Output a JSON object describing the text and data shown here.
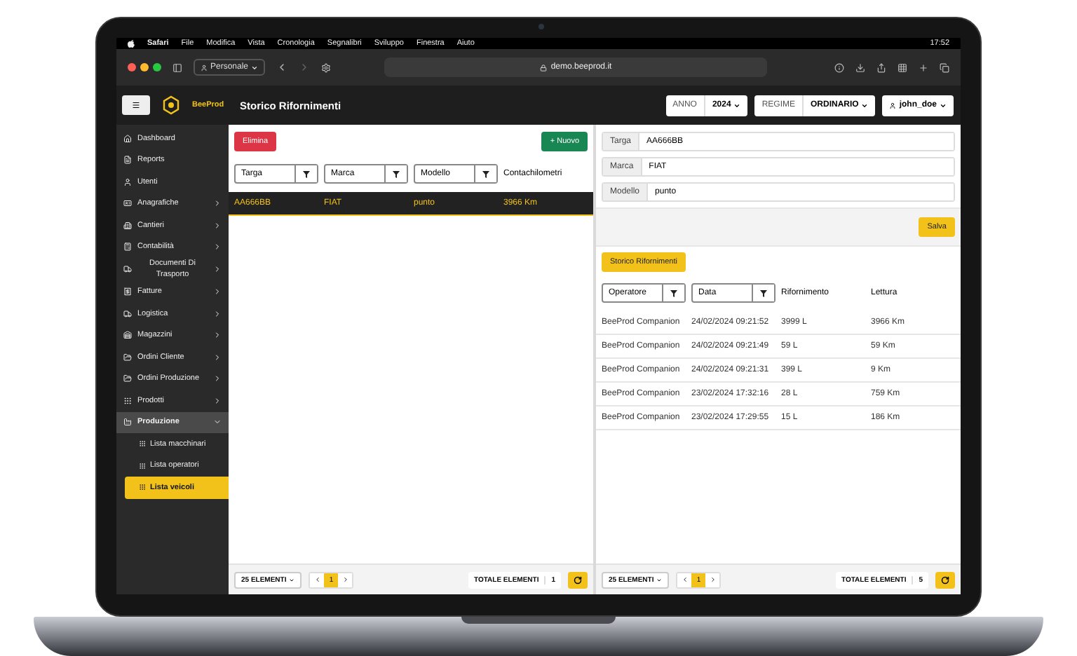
{
  "menubar": {
    "items": [
      "Safari",
      "File",
      "Modifica",
      "Vista",
      "Cronologia",
      "Segnalibri",
      "Sviluppo",
      "Finestra",
      "Aiuto"
    ],
    "time": "17:52"
  },
  "browser": {
    "profile": "Personale",
    "url": "demo.beeprod.it"
  },
  "header": {
    "logo_text": "BeeProd",
    "title": "Storico Rifornimenti",
    "anno_label": "ANNO",
    "anno_value": "2024",
    "regime_label": "REGIME",
    "regime_value": "ORDINARIO",
    "user": "john_doe"
  },
  "sidebar": {
    "items": [
      {
        "label": "Dashboard",
        "submenu": false,
        "expanded": false
      },
      {
        "label": "Reports",
        "submenu": false,
        "expanded": false
      },
      {
        "label": "Utenti",
        "submenu": false,
        "expanded": false
      },
      {
        "label": "Anagrafiche",
        "submenu": true,
        "expanded": false
      },
      {
        "label": "Cantieri",
        "submenu": true,
        "expanded": false
      },
      {
        "label": "Contabilità",
        "submenu": true,
        "expanded": false
      },
      {
        "label": "Documenti Di Trasporto",
        "submenu": true,
        "expanded": false
      },
      {
        "label": "Fatture",
        "submenu": true,
        "expanded": false
      },
      {
        "label": "Logistica",
        "submenu": true,
        "expanded": false
      },
      {
        "label": "Magazzini",
        "submenu": true,
        "expanded": false
      },
      {
        "label": "Ordini Cliente",
        "submenu": true,
        "expanded": false
      },
      {
        "label": "Ordini Produzione",
        "submenu": true,
        "expanded": false
      },
      {
        "label": "Prodotti",
        "submenu": true,
        "expanded": false
      },
      {
        "label": "Produzione",
        "submenu": true,
        "expanded": true,
        "children": [
          {
            "label": "Lista macchinari",
            "selected": false
          },
          {
            "label": "Lista operatori",
            "selected": false
          },
          {
            "label": "Lista veicoli",
            "selected": true
          }
        ]
      }
    ]
  },
  "vehicles": {
    "delete_button": "Elimina",
    "new_button": "+ Nuovo",
    "columns": [
      {
        "kind": "filter",
        "label": "Targa"
      },
      {
        "kind": "filter",
        "label": "Marca"
      },
      {
        "kind": "filter",
        "label": "Modello"
      },
      {
        "kind": "text",
        "label": "Contachilometri"
      }
    ],
    "rows": [
      {
        "cells": [
          "AA666BB",
          "FIAT",
          "punto",
          "3966 Km"
        ],
        "selected": true
      }
    ],
    "footer": {
      "page_size": "25 ELEMENTI",
      "page": "1",
      "total_label": "TOTALE ELEMENTI",
      "total": "1"
    }
  },
  "detail": {
    "fields": [
      {
        "label": "Targa",
        "value": "AA666BB"
      },
      {
        "label": "Marca",
        "value": "FIAT"
      },
      {
        "label": "Modello",
        "value": "punto"
      }
    ],
    "save_button": "Salva",
    "history_button": "Storico Rifornimenti",
    "columns": [
      {
        "kind": "filter",
        "label": "Operatore"
      },
      {
        "kind": "filter",
        "label": "Data"
      },
      {
        "kind": "text",
        "label": "Rifornimento"
      },
      {
        "kind": "text",
        "label": "Lettura"
      }
    ],
    "rows": [
      {
        "cells": [
          "BeeProd Companion",
          "24/02/2024 09:21:52",
          "3999 L",
          "3966 Km"
        ]
      },
      {
        "cells": [
          "BeeProd Companion",
          "24/02/2024 09:21:49",
          "59 L",
          "59 Km"
        ]
      },
      {
        "cells": [
          "BeeProd Companion",
          "24/02/2024 09:21:31",
          "399 L",
          "9 Km"
        ]
      },
      {
        "cells": [
          "BeeProd Companion",
          "23/02/2024 17:32:16",
          "28 L",
          "759 Km"
        ]
      },
      {
        "cells": [
          "BeeProd Companion",
          "23/02/2024 17:29:55",
          "15 L",
          "186 Km"
        ]
      }
    ],
    "footer": {
      "page_size": "25 ELEMENTI",
      "page": "1",
      "total_label": "TOTALE ELEMENTI",
      "total": "5"
    }
  }
}
